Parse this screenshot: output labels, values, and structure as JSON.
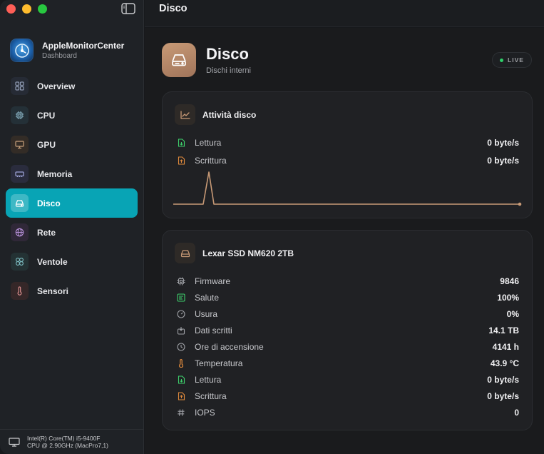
{
  "app": {
    "name": "AppleMonitorCenter",
    "subtitle": "Dashboard"
  },
  "sidebar": {
    "items": [
      {
        "label": "Overview",
        "icon": "grid-icon",
        "color": "#8f9bb3"
      },
      {
        "label": "CPU",
        "icon": "chip-icon",
        "color": "#7fa6b6"
      },
      {
        "label": "GPU",
        "icon": "display-icon",
        "color": "#c7a07b"
      },
      {
        "label": "Memoria",
        "icon": "memory-icon",
        "color": "#9ea3d8"
      },
      {
        "label": "Disco",
        "icon": "drive-icon",
        "color": "#ffffff"
      },
      {
        "label": "Rete",
        "icon": "globe-icon",
        "color": "#b58fd6"
      },
      {
        "label": "Ventole",
        "icon": "fan-icon",
        "color": "#7fc1c6"
      },
      {
        "label": "Sensori",
        "icon": "thermometer-icon",
        "color": "#d98d8d"
      }
    ],
    "active_index": 4,
    "system": {
      "line1": "Intel(R) Core(TM) i5-9400F",
      "line2": "CPU @ 2.90GHz (MacPro7,1)"
    }
  },
  "topbar": {
    "title": "Disco"
  },
  "page": {
    "title": "Disco",
    "subtitle": "Dischi interni",
    "live_label": "LIVE"
  },
  "activity": {
    "title": "Attività disco",
    "rows": [
      {
        "label": "Lettura",
        "value": "0 byte/s",
        "icon": "file-download-icon",
        "color": "#3ecf6b"
      },
      {
        "label": "Scrittura",
        "value": "0 byte/s",
        "icon": "file-upload-icon",
        "color": "#e08a3c"
      }
    ]
  },
  "drive": {
    "title": "Lexar SSD NM620 2TB",
    "rows": [
      {
        "label": "Firmware",
        "value": "9846",
        "icon": "chip-icon",
        "color": "#9fa1a6"
      },
      {
        "label": "Salute",
        "value": "100%",
        "icon": "health-icon",
        "color": "#3ecf6b"
      },
      {
        "label": "Usura",
        "value": "0%",
        "icon": "gauge-icon",
        "color": "#9fa1a6"
      },
      {
        "label": "Dati scritti",
        "value": "14.1 TB",
        "icon": "write-icon",
        "color": "#9fa1a6"
      },
      {
        "label": "Ore di accensione",
        "value": "4141 h",
        "icon": "clock-icon",
        "color": "#9fa1a6"
      },
      {
        "label": "Temperatura",
        "value": "43.9 °C",
        "icon": "thermometer-icon",
        "color": "#e08a3c"
      },
      {
        "label": "Lettura",
        "value": "0 byte/s",
        "icon": "file-download-icon",
        "color": "#3ecf6b"
      },
      {
        "label": "Scrittura",
        "value": "0 byte/s",
        "icon": "file-upload-icon",
        "color": "#e08a3c"
      },
      {
        "label": "IOPS",
        "value": "0",
        "icon": "hash-icon",
        "color": "#9fa1a6"
      }
    ]
  },
  "colors": {
    "accent": "#08a4b5",
    "disk": "#c89a76",
    "live": "#2fd06a"
  }
}
